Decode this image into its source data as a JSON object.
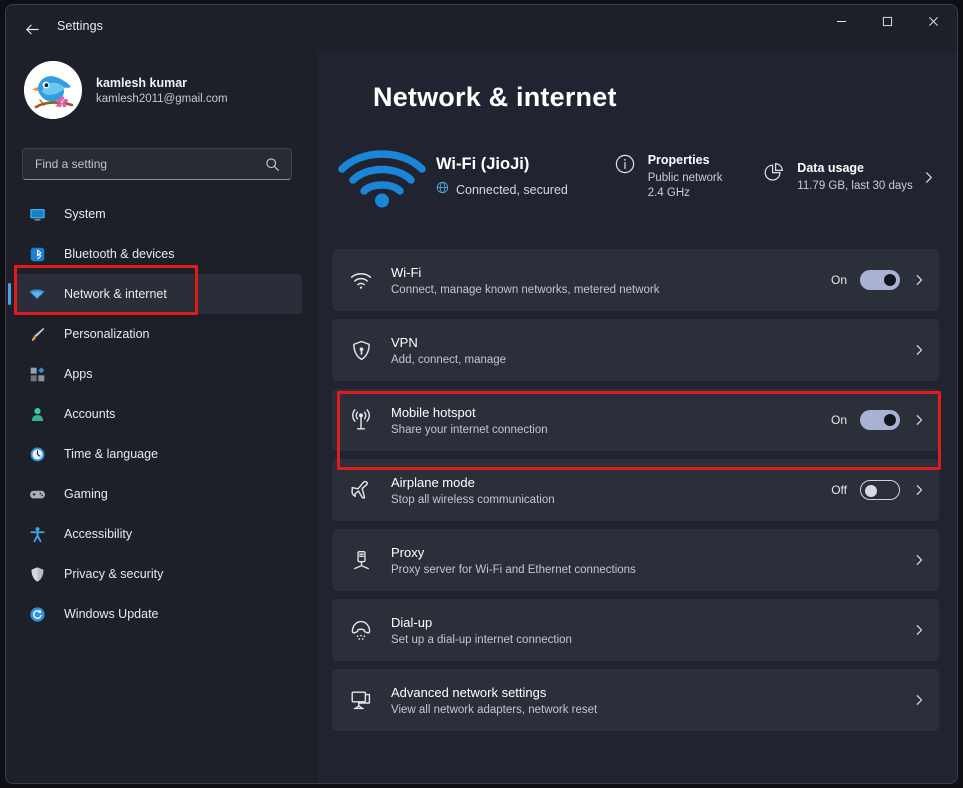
{
  "window": {
    "app_title": "Settings",
    "back_icon": "back-arrow-icon",
    "minimize_label": "Minimize",
    "maximize_label": "Maximize",
    "close_label": "Close"
  },
  "account": {
    "name": "kamlesh kumar",
    "email": "kamlesh2011@gmail.com",
    "avatar_icon": "bird-avatar"
  },
  "search": {
    "placeholder": "Find a setting",
    "value": "",
    "icon": "search-icon"
  },
  "sidebar": {
    "items": [
      {
        "label": "System",
        "icon": "system-icon",
        "selected": false
      },
      {
        "label": "Bluetooth & devices",
        "icon": "bluetooth-icon",
        "selected": false
      },
      {
        "label": "Network & internet",
        "icon": "network-wifi-icon",
        "selected": true
      },
      {
        "label": "Personalization",
        "icon": "paintbrush-icon",
        "selected": false
      },
      {
        "label": "Apps",
        "icon": "apps-icon",
        "selected": false
      },
      {
        "label": "Accounts",
        "icon": "person-icon",
        "selected": false
      },
      {
        "label": "Time & language",
        "icon": "clock-icon",
        "selected": false
      },
      {
        "label": "Gaming",
        "icon": "gamepad-icon",
        "selected": false
      },
      {
        "label": "Accessibility",
        "icon": "accessibility-icon",
        "selected": false
      },
      {
        "label": "Privacy & security",
        "icon": "shield-icon",
        "selected": false
      },
      {
        "label": "Windows Update",
        "icon": "update-refresh-icon",
        "selected": false
      }
    ]
  },
  "main": {
    "page_title": "Network & internet",
    "hero": {
      "wifi_icon": "wifi-signal-icon",
      "ssid": "Wi-Fi (JioJi)",
      "status": "Connected, secured",
      "status_icon": "globe-icon",
      "properties": {
        "icon": "info-circle-icon",
        "title": "Properties",
        "line1": "Public network",
        "line2": "2.4 GHz"
      },
      "data_usage": {
        "icon": "pie-chart-icon",
        "title": "Data usage",
        "line1": "11.79 GB, last 30 days"
      },
      "chevron_icon": "chevron-right-icon"
    },
    "cards": [
      {
        "icon": "wifi-icon",
        "title": "Wi-Fi",
        "subtitle": "Connect, manage known networks, metered network",
        "toggle_state": "On",
        "toggle_on": true,
        "chevron_icon": "chevron-right-icon"
      },
      {
        "icon": "vpn-shield-icon",
        "title": "VPN",
        "subtitle": "Add, connect, manage",
        "toggle_state": null,
        "toggle_on": null,
        "chevron_icon": "chevron-right-icon"
      },
      {
        "icon": "mobile-hotspot-icon",
        "title": "Mobile hotspot",
        "subtitle": "Share your internet connection",
        "toggle_state": "On",
        "toggle_on": true,
        "chevron_icon": "chevron-right-icon"
      },
      {
        "icon": "airplane-icon",
        "title": "Airplane mode",
        "subtitle": "Stop all wireless communication",
        "toggle_state": "Off",
        "toggle_on": false,
        "chevron_icon": "chevron-right-icon"
      },
      {
        "icon": "proxy-server-icon",
        "title": "Proxy",
        "subtitle": "Proxy server for Wi-Fi and Ethernet connections",
        "toggle_state": null,
        "toggle_on": null,
        "chevron_icon": "chevron-right-icon"
      },
      {
        "icon": "dialup-phone-icon",
        "title": "Dial-up",
        "subtitle": "Set up a dial-up internet connection",
        "toggle_state": null,
        "toggle_on": null,
        "chevron_icon": "chevron-right-icon"
      },
      {
        "icon": "monitor-network-icon",
        "title": "Advanced network settings",
        "subtitle": "View all network adapters, network reset",
        "toggle_state": null,
        "toggle_on": null,
        "chevron_icon": "chevron-right-icon"
      }
    ]
  },
  "annotations": {
    "highlight_color": "#e01b1b",
    "boxes": [
      {
        "target": "sidebar-item-network-internet"
      },
      {
        "target": "card-mobile-hotspot"
      }
    ]
  }
}
